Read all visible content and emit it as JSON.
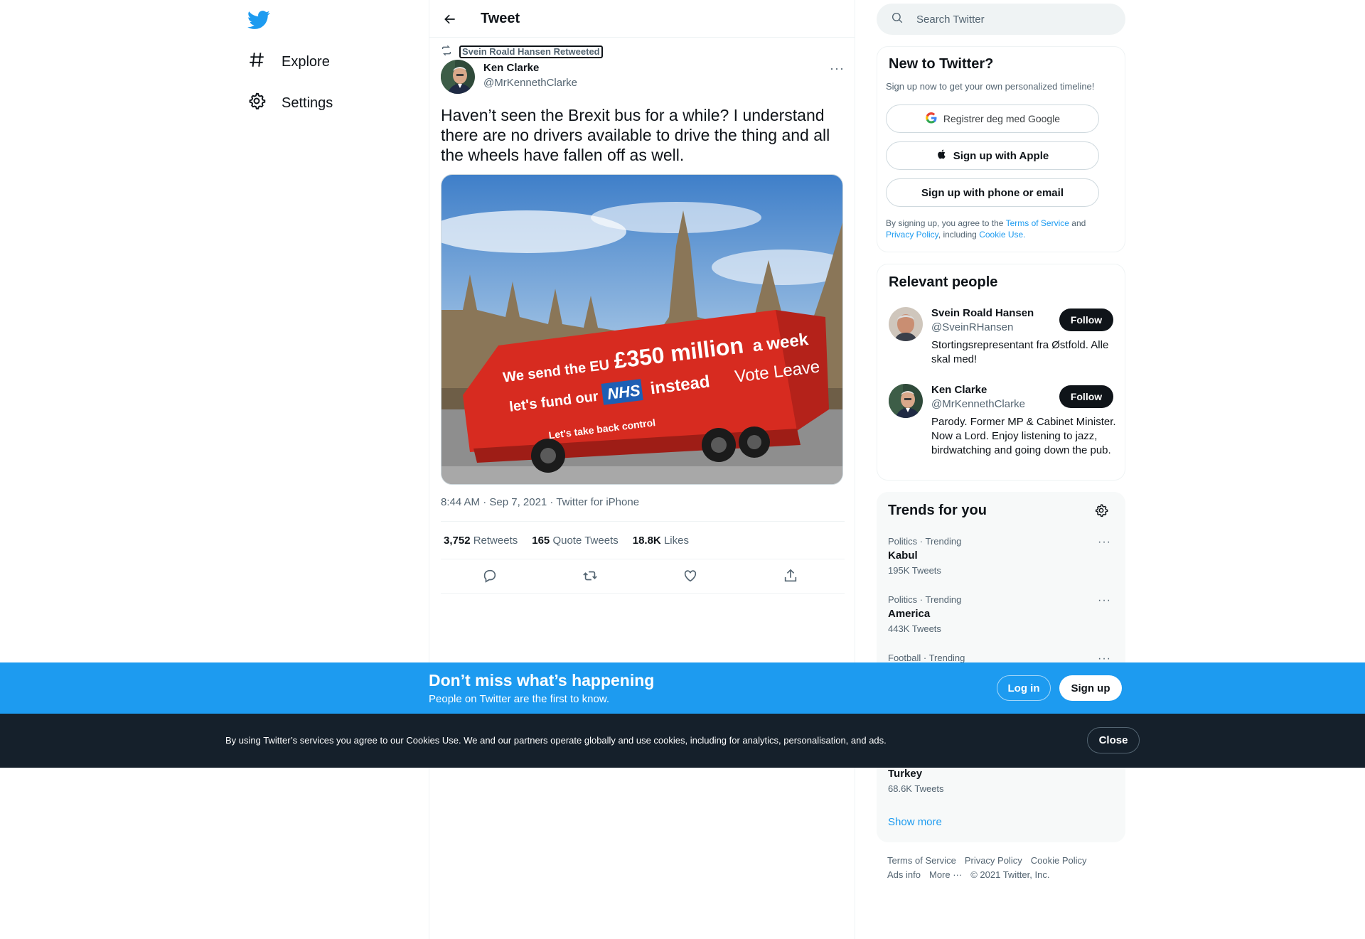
{
  "nav": {
    "explore_label": "Explore",
    "settings_label": "Settings"
  },
  "header": {
    "title": "Tweet"
  },
  "tweet": {
    "retweeted_by": "Svein Roald Hansen Retweeted",
    "author_name": "Ken Clarke",
    "author_handle": "@MrKennethClarke",
    "text": "Haven’t seen the Brexit bus for a while? I understand there are no drivers available to drive the thing and all the wheels have fallen off as well.",
    "media": {
      "line1a": "We send the EU",
      "line1b": "£350 million",
      "line1c": "a week",
      "line2a": "let's fund our",
      "line2b": "NHS",
      "line2c": "instead",
      "line2d": "Vote Leave",
      "line3": "Let's take back control"
    },
    "meta": "8:44 AM · Sep 7, 2021 · Twitter for iPhone",
    "stats": {
      "retweets_count": "3,752",
      "retweets_label": "Retweets",
      "quotes_count": "165",
      "quotes_label": "Quote Tweets",
      "likes_count": "18.8K",
      "likes_label": "Likes"
    }
  },
  "search": {
    "placeholder": "Search Twitter"
  },
  "signup_card": {
    "title": "New to Twitter?",
    "subtitle": "Sign up now to get your own personalized timeline!",
    "google_label": "Registrer deg med Google",
    "apple_label": "Sign up with Apple",
    "phone_label": "Sign up with phone or email",
    "terms_prefix": "By signing up, you agree to the",
    "terms_link": "Terms of Service",
    "terms_and": "and",
    "privacy_link": "Privacy Policy",
    "including": ", including",
    "cookie_link": "Cookie Use."
  },
  "relevant": {
    "title": "Relevant people",
    "people": [
      {
        "name": "Svein Roald Hansen",
        "handle": "@SveinRHansen",
        "bio": "Stortingsrepresentant fra Østfold. Alle skal med!",
        "follow": "Follow"
      },
      {
        "name": "Ken Clarke",
        "handle": "@MrKennethClarke",
        "bio": "Parody. Former MP & Cabinet Minister. Now a Lord. Enjoy listening to jazz, birdwatching and going down the pub.",
        "follow": "Follow"
      }
    ]
  },
  "trends": {
    "title": "Trends for you",
    "items": [
      {
        "category": "Politics · Trending",
        "name": "Kabul",
        "count": "195K Tweets"
      },
      {
        "category": "Politics · Trending",
        "name": "America",
        "count": "443K Tweets"
      },
      {
        "category": "Football · Trending"
      },
      {
        "name": "Turkey",
        "count": "68.6K Tweets"
      }
    ],
    "show_more": "Show more"
  },
  "footer": {
    "terms": "Terms of Service",
    "privacy": "Privacy Policy",
    "cookie": "Cookie Policy",
    "ads": "Ads info",
    "more": "More ···",
    "copyright": "© 2021 Twitter, Inc."
  },
  "banner": {
    "title": "Don’t miss what’s happening",
    "subtitle": "People on Twitter are the first to know.",
    "login": "Log in",
    "signup": "Sign up"
  },
  "cookie_bar": {
    "text": "By using Twitter’s services you agree to our Cookies Use. We and our partners operate globally and use cookies, including for analytics, personalisation, and ads.",
    "close": "Close"
  },
  "colors": {
    "accent": "#1d9bf0",
    "text": "#0f1419",
    "secondary": "#536471",
    "cookie_bg": "#15202b"
  }
}
